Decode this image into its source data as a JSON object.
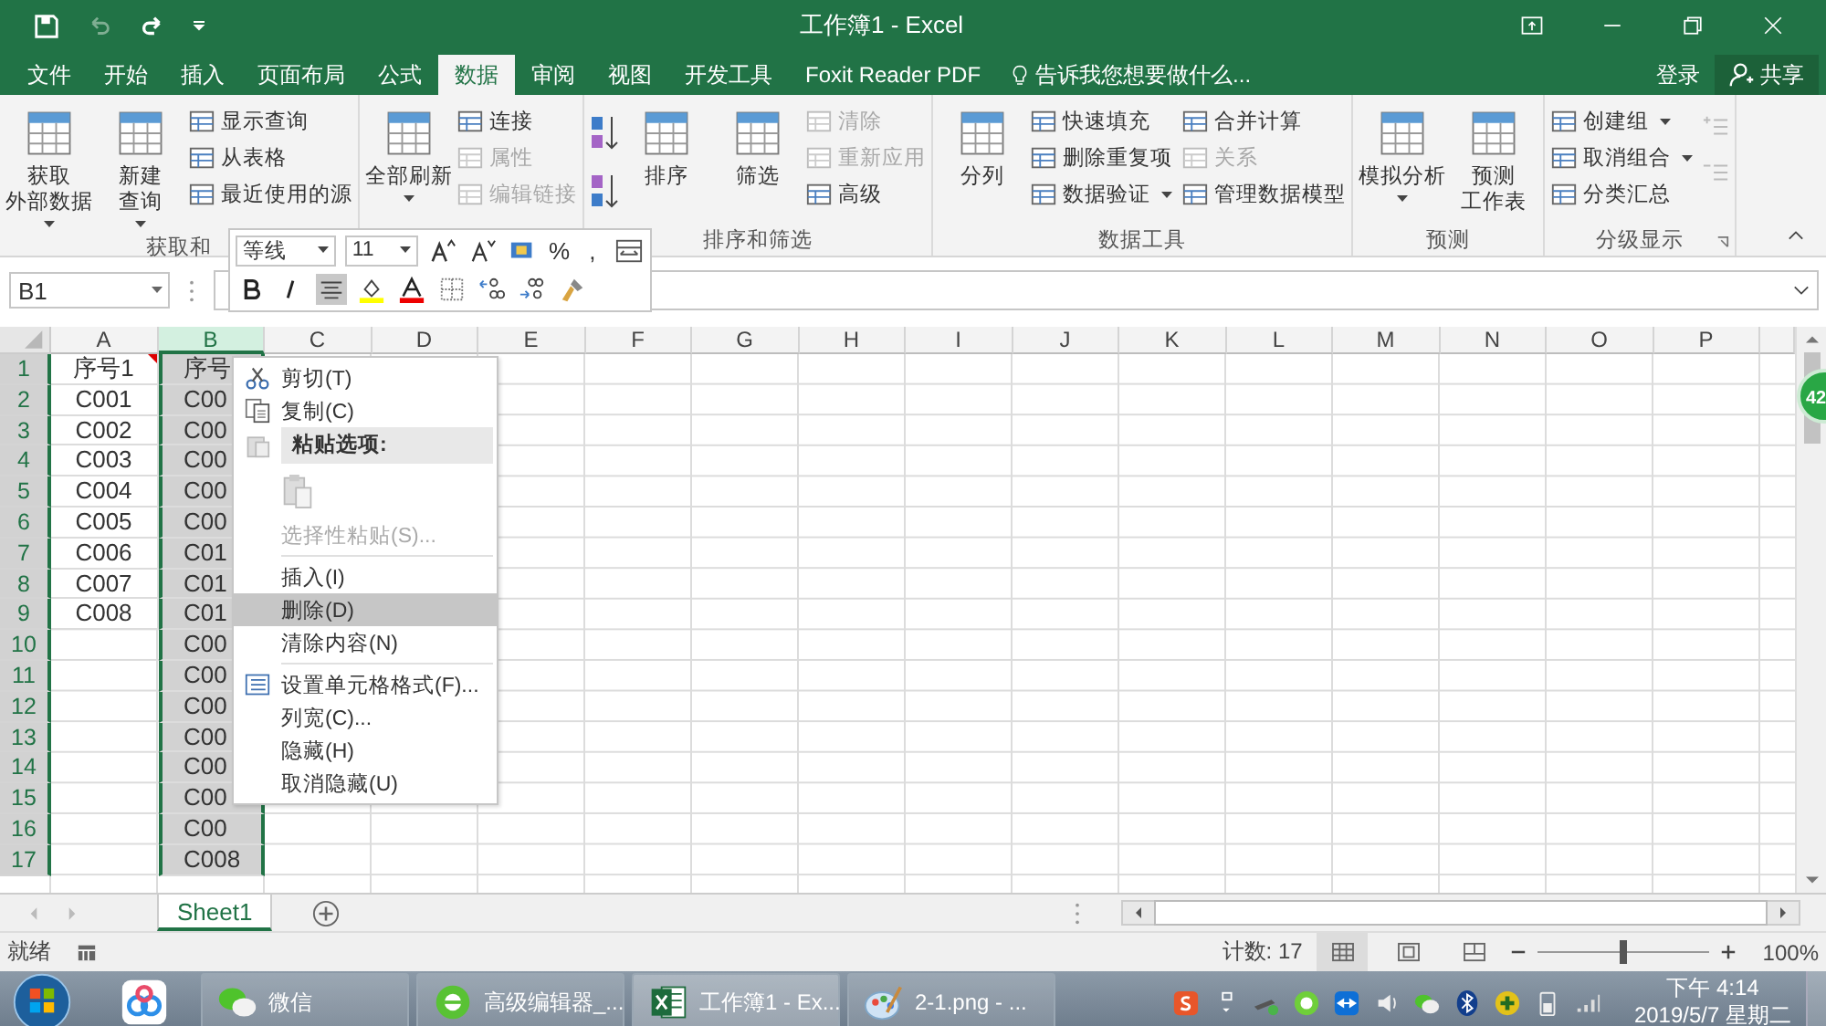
{
  "window": {
    "title": "工作簿1 - Excel"
  },
  "tabs": [
    {
      "label": "文件",
      "selected": false
    },
    {
      "label": "开始",
      "selected": false
    },
    {
      "label": "插入",
      "selected": false
    },
    {
      "label": "页面布局",
      "selected": false
    },
    {
      "label": "公式",
      "selected": false
    },
    {
      "label": "数据",
      "selected": true
    },
    {
      "label": "审阅",
      "selected": false
    },
    {
      "label": "视图",
      "selected": false
    },
    {
      "label": "开发工具",
      "selected": false
    },
    {
      "label": "Foxit Reader PDF",
      "selected": false
    }
  ],
  "tell_me": "告诉我您想要做什么...",
  "account": {
    "sign_in": "登录",
    "share": "共享"
  },
  "ribbon": {
    "groups": [
      {
        "label": "获取和",
        "columns": [
          {
            "kind": "large",
            "lines": [
              "获取",
              "外部数据"
            ],
            "dropdown": true
          },
          {
            "kind": "large",
            "lines": [
              "新建",
              "查询"
            ],
            "dropdown": true
          },
          {
            "kind": "stack",
            "items": [
              {
                "label": "显示查询",
                "disabled": false,
                "dropdown": false
              },
              {
                "label": "从表格",
                "disabled": false,
                "dropdown": false
              },
              {
                "label": "最近使用的源",
                "disabled": false,
                "dropdown": false
              }
            ]
          }
        ]
      },
      {
        "columns": [
          {
            "kind": "large",
            "lines": [
              "全部刷新"
            ],
            "dropdown": true
          },
          {
            "kind": "stack",
            "items": [
              {
                "label": "连接",
                "disabled": false,
                "dropdown": false
              },
              {
                "label": "属性",
                "disabled": true,
                "dropdown": false
              },
              {
                "label": "编辑链接",
                "disabled": true,
                "dropdown": false
              }
            ]
          }
        ]
      },
      {
        "label": "排序和筛选",
        "columns": [
          {
            "kind": "sort_pair"
          },
          {
            "kind": "large",
            "lines": [
              "排序"
            ],
            "dropdown": false
          },
          {
            "kind": "large",
            "lines": [
              "筛选"
            ],
            "dropdown": false
          },
          {
            "kind": "stack",
            "items": [
              {
                "label": "清除",
                "disabled": true,
                "dropdown": false
              },
              {
                "label": "重新应用",
                "disabled": true,
                "dropdown": false
              },
              {
                "label": "高级",
                "disabled": false,
                "dropdown": false
              }
            ]
          }
        ]
      },
      {
        "label": "数据工具",
        "columns": [
          {
            "kind": "large",
            "lines": [
              "分列"
            ],
            "dropdown": false
          },
          {
            "kind": "stack",
            "items": [
              {
                "label": "快速填充",
                "disabled": false,
                "dropdown": false
              },
              {
                "label": "删除重复项",
                "disabled": false,
                "dropdown": false
              },
              {
                "label": "数据验证",
                "disabled": false,
                "dropdown": true
              }
            ]
          },
          {
            "kind": "stack",
            "items": [
              {
                "label": "合并计算",
                "disabled": false,
                "dropdown": false
              },
              {
                "label": "关系",
                "disabled": true,
                "dropdown": false
              },
              {
                "label": "管理数据模型",
                "disabled": false,
                "dropdown": false
              }
            ]
          }
        ]
      },
      {
        "label": "预测",
        "columns": [
          {
            "kind": "large",
            "lines": [
              "模拟分析"
            ],
            "dropdown": true
          },
          {
            "kind": "large",
            "lines": [
              "预测",
              "工作表"
            ],
            "dropdown": false
          }
        ]
      },
      {
        "label": "分级显示",
        "columns": [
          {
            "kind": "stack",
            "items": [
              {
                "label": "创建组",
                "disabled": false,
                "dropdown": true
              },
              {
                "label": "取消组合",
                "disabled": false,
                "dropdown": true
              },
              {
                "label": "分类汇总",
                "disabled": false,
                "dropdown": false
              }
            ]
          },
          {
            "kind": "outline_pair"
          }
        ]
      }
    ]
  },
  "name_box": "B1",
  "mini_toolbar": {
    "font": "等线",
    "size": "11",
    "percent": "%",
    "comma": ","
  },
  "sheet": {
    "columns": [
      {
        "label": "A",
        "selected": false
      },
      {
        "label": "B",
        "selected": true
      },
      {
        "label": "C",
        "selected": false
      },
      {
        "label": "D",
        "selected": false
      },
      {
        "label": "E",
        "selected": false
      },
      {
        "label": "F",
        "selected": false
      },
      {
        "label": "G",
        "selected": false
      },
      {
        "label": "H",
        "selected": false
      },
      {
        "label": "I",
        "selected": false
      },
      {
        "label": "J",
        "selected": false
      },
      {
        "label": "K",
        "selected": false
      },
      {
        "label": "L",
        "selected": false
      },
      {
        "label": "M",
        "selected": false
      },
      {
        "label": "N",
        "selected": false
      },
      {
        "label": "O",
        "selected": false
      },
      {
        "label": "P",
        "selected": false
      }
    ],
    "rows": [
      {
        "number": "1",
        "selected": true,
        "cells": [
          "序号1",
          "序号"
        ]
      },
      {
        "number": "2",
        "selected": true,
        "cells": [
          "C001",
          "C00"
        ]
      },
      {
        "number": "3",
        "selected": true,
        "cells": [
          "C002",
          "C00"
        ]
      },
      {
        "number": "4",
        "selected": true,
        "cells": [
          "C003",
          "C00"
        ]
      },
      {
        "number": "5",
        "selected": true,
        "cells": [
          "C004",
          "C00"
        ]
      },
      {
        "number": "6",
        "selected": true,
        "cells": [
          "C005",
          "C00"
        ]
      },
      {
        "number": "7",
        "selected": true,
        "cells": [
          "C006",
          "C01"
        ]
      },
      {
        "number": "8",
        "selected": true,
        "cells": [
          "C007",
          "C01"
        ]
      },
      {
        "number": "9",
        "selected": true,
        "cells": [
          "C008",
          "C01"
        ]
      },
      {
        "number": "10",
        "selected": true,
        "cells": [
          "",
          "C00"
        ]
      },
      {
        "number": "11",
        "selected": true,
        "cells": [
          "",
          "C00"
        ]
      },
      {
        "number": "12",
        "selected": true,
        "cells": [
          "",
          "C00"
        ]
      },
      {
        "number": "13",
        "selected": true,
        "cells": [
          "",
          "C00"
        ]
      },
      {
        "number": "14",
        "selected": true,
        "cells": [
          "",
          "C00"
        ]
      },
      {
        "number": "15",
        "selected": true,
        "cells": [
          "",
          "C00"
        ]
      },
      {
        "number": "16",
        "selected": true,
        "cells": [
          "",
          "C00"
        ]
      },
      {
        "number": "17",
        "selected": true,
        "cells": [
          "",
          "C008"
        ]
      }
    ]
  },
  "context_menu": [
    {
      "kind": "cut",
      "label": "剪切(T)",
      "disabled": false,
      "selected": false
    },
    {
      "kind": "copy",
      "label": "复制(C)",
      "disabled": false,
      "selected": false
    },
    {
      "kind": "header",
      "label": "粘贴选项:"
    },
    {
      "kind": "paste_icons"
    },
    {
      "kind": "plain",
      "label": "选择性粘贴(S)...",
      "disabled": true,
      "selected": false
    },
    {
      "kind": "separator"
    },
    {
      "kind": "plain",
      "label": "插入(I)",
      "disabled": false,
      "selected": false
    },
    {
      "kind": "plain",
      "label": "删除(D)",
      "disabled": false,
      "selected": true
    },
    {
      "kind": "plain",
      "label": "清除内容(N)",
      "disabled": false,
      "selected": false
    },
    {
      "kind": "separator"
    },
    {
      "kind": "format",
      "label": "设置单元格格式(F)...",
      "disabled": false,
      "selected": false
    },
    {
      "kind": "plain",
      "label": "列宽(C)...",
      "disabled": false,
      "selected": false
    },
    {
      "kind": "plain",
      "label": "隐藏(H)",
      "disabled": false,
      "selected": false
    },
    {
      "kind": "plain",
      "label": "取消隐藏(U)",
      "disabled": false,
      "selected": false
    }
  ],
  "float_badge": "42",
  "sheet_tabs": [
    {
      "label": "Sheet1",
      "selected": true
    }
  ],
  "status_bar": {
    "status": "就绪",
    "count": "计数: 17",
    "views": [
      {
        "selected": true
      },
      {
        "selected": false
      },
      {
        "selected": false
      }
    ],
    "zoom": {
      "level": 0.5,
      "reading": "100%"
    }
  },
  "taskbar": {
    "windows": [
      {
        "kind": "chat",
        "label": "微信"
      },
      {
        "kind": "browser",
        "label": "高级编辑器_..."
      },
      {
        "kind": "excel",
        "label": "工作簿1 - Ex..."
      },
      {
        "kind": "paint",
        "label": "2-1.png - ..."
      }
    ],
    "time": "下午 4:14",
    "date": "2019/5/7 星期二"
  }
}
